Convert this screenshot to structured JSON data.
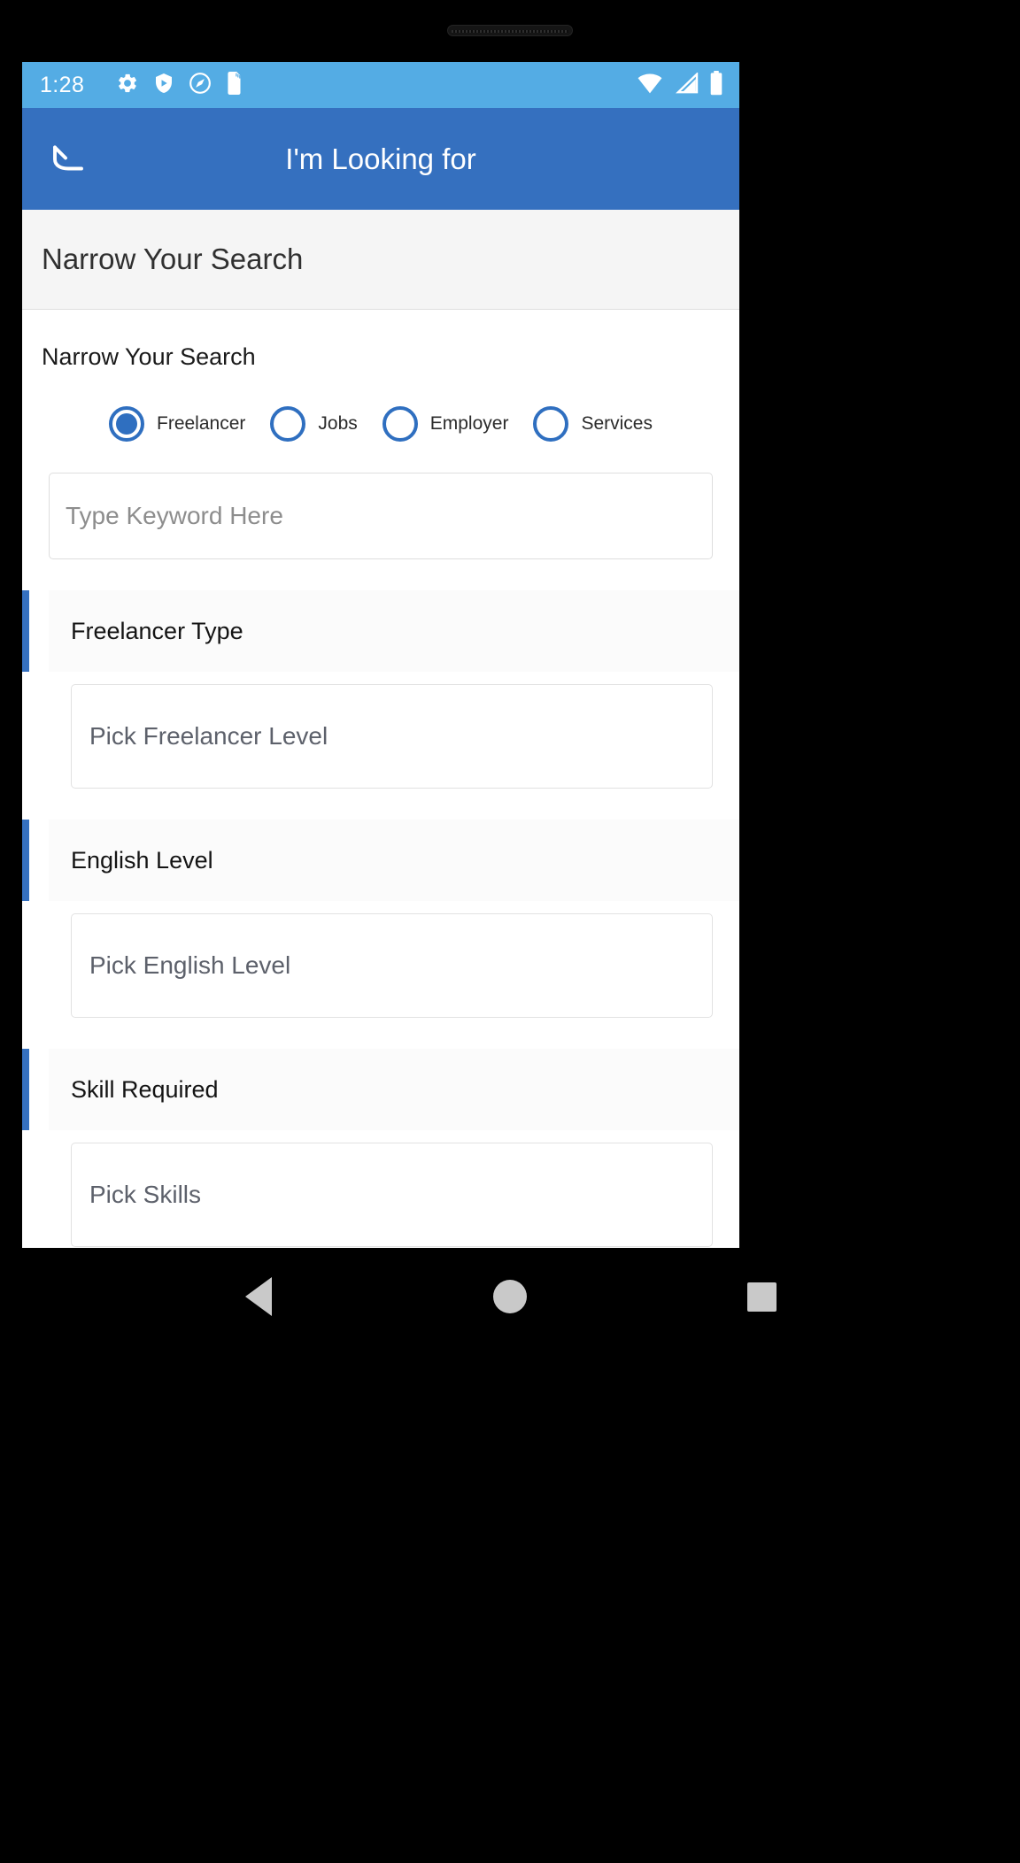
{
  "status_bar": {
    "time": "1:28",
    "left_icons": [
      "settings-gear-icon",
      "play-protect-shield-icon",
      "location-pin-icon",
      "sd-card-icon"
    ],
    "right_icons": [
      "wifi-icon",
      "cellular-signal-icon",
      "battery-icon"
    ],
    "background": "#54ace4"
  },
  "app_bar": {
    "title": "I'm Looking for",
    "back_icon": "back-arrow-icon",
    "background": "#3570bf"
  },
  "sub_header": {
    "title": "Narrow Your Search"
  },
  "content": {
    "section_label": "Narrow Your Search",
    "radio_options": [
      {
        "label": "Freelancer",
        "selected": true
      },
      {
        "label": "Jobs",
        "selected": false
      },
      {
        "label": "Employer",
        "selected": false
      },
      {
        "label": "Services",
        "selected": false
      }
    ],
    "keyword_field": {
      "value": "",
      "placeholder": "Type Keyword Here"
    },
    "filter_groups": [
      {
        "title": "Freelancer Type",
        "select_text": "Pick Freelancer Level"
      },
      {
        "title": "English Level",
        "select_text": "Pick English Level"
      },
      {
        "title": "Skill Required",
        "select_text": "Pick Skills"
      }
    ],
    "accent_color": "#3570bf"
  },
  "nav_bar": {
    "buttons": [
      "nav-back-icon",
      "nav-home-icon",
      "nav-recents-icon"
    ]
  }
}
